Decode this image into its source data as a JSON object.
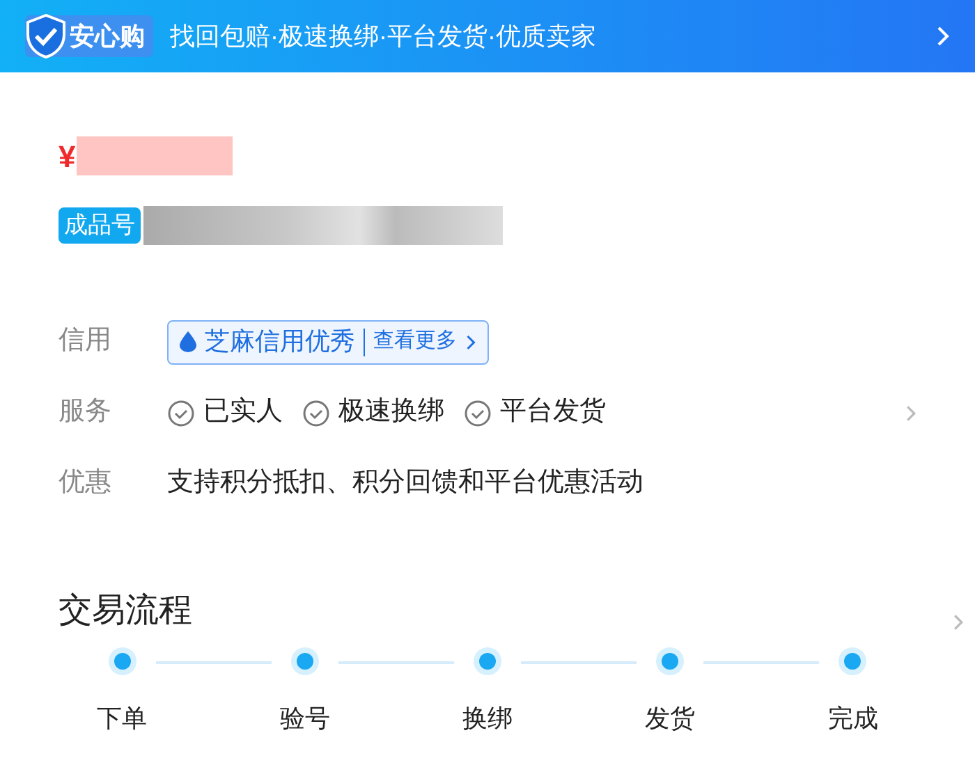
{
  "banner": {
    "badge": "安心购",
    "text": "找回包赔·极速换绑·平台发货·优质卖家"
  },
  "product": {
    "price_symbol": "¥",
    "tag": "成品号"
  },
  "info": [
    {
      "kind": "credit",
      "label": "信用",
      "credit": "芝麻信用优秀",
      "more": "查看更多"
    },
    {
      "kind": "services",
      "label": "服务",
      "items": [
        "已实人",
        "极速换绑",
        "平台发货"
      ]
    },
    {
      "kind": "text",
      "label": "优惠",
      "text": "支持积分抵扣、积分回馈和平台优惠活动"
    }
  ],
  "process": {
    "title": "交易流程",
    "steps": [
      "下单",
      "验号",
      "换绑",
      "发货",
      "完成"
    ]
  }
}
